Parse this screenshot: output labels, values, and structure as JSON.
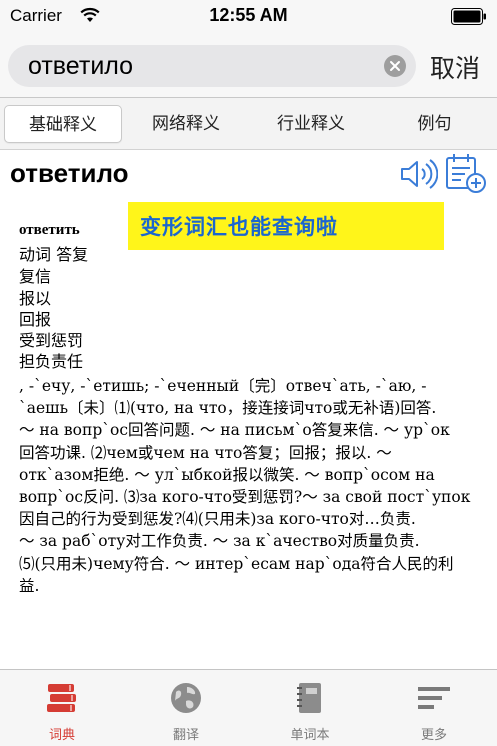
{
  "status_bar": {
    "carrier": "Carrier",
    "time": "12:55 AM"
  },
  "search": {
    "query": "ответило",
    "cancel_label": "取消"
  },
  "tabs": [
    {
      "label": "基础释义"
    },
    {
      "label": "网络释义"
    },
    {
      "label": "行业释义"
    },
    {
      "label": "例句"
    }
  ],
  "word": {
    "title": "ответило"
  },
  "banner": {
    "text": "变形词汇也能查询啦"
  },
  "definition": {
    "headword": "ответить",
    "senses": [
      "动词 答复",
      "复信",
      "报以",
      "回报",
      "受到惩罚",
      "担负责任"
    ],
    "paragraph": [
      ", -`ечу, -`етишь; -`еченный〔完〕отвеч`ать, -`аю, -",
      "`аешь〔未〕⑴(что, на что，接连接词что或无补语)回答.",
      "～ на вопр`ос回答问题. ～ на письм`о答复来信. ～ ур`ок",
      "回答功课. ⑵чем或чем на что答复；回报；报以. ～",
      "отк`азом拒绝. ～ ул`ыбкой报以微笑. ～ вопр`осом на",
      "вопр`ос反问. ⑶за кого-что受到惩罚?～ за свой пост`упок",
      "因自己的行为受到惩发?⑷(只用未)за кого-что对…负责.",
      "～ за раб`оту对工作负责. ～ за к`ачество对质量负责.",
      "⑸(只用未)чему符合. ～ интер`есам нар`ода符合人民的利",
      "益."
    ]
  },
  "tabbar": [
    {
      "label": "词典",
      "icon": "books-icon",
      "active": true
    },
    {
      "label": "翻译",
      "icon": "globe-icon",
      "active": false
    },
    {
      "label": "单词本",
      "icon": "notebook-icon",
      "active": false
    },
    {
      "label": "更多",
      "icon": "menu-lines-icon",
      "active": false
    }
  ],
  "colors": {
    "active_tab": "#d53c34",
    "banner_bg": "#fff51a",
    "banner_text": "#1b66cf",
    "icon_blue": "#3b7dd8"
  }
}
